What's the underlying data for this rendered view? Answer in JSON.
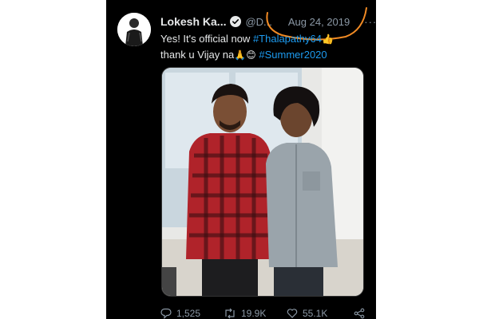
{
  "tweet": {
    "author_name": "Lokesh Ka...",
    "handle": "@D...",
    "timestamp": "Aug 24, 2019",
    "more_label": "···",
    "text_part1": "Yes! It's official now ",
    "hashtag1": "#Thalapathy64",
    "emoji1": "👍",
    "text_part2": "thank u Vijay na",
    "emoji2": "🙏😊",
    "hashtag2": "#Summer2020",
    "media": {
      "description_visible": false
    }
  },
  "actions": {
    "replies": "1,525",
    "retweets": "19.9K",
    "likes": "55.1K"
  },
  "colors": {
    "background": "#000000",
    "text": "#e7e9ea",
    "secondary": "#8b98a5",
    "link": "#1d9bf0",
    "verified": "#1d9bf0",
    "annotation": "#f08a24"
  },
  "icons": {
    "verified": "verified-badge-icon",
    "more": "more-options-icon",
    "reply": "reply-icon",
    "retweet": "retweet-icon",
    "like": "heart-icon",
    "share": "share-icon"
  }
}
